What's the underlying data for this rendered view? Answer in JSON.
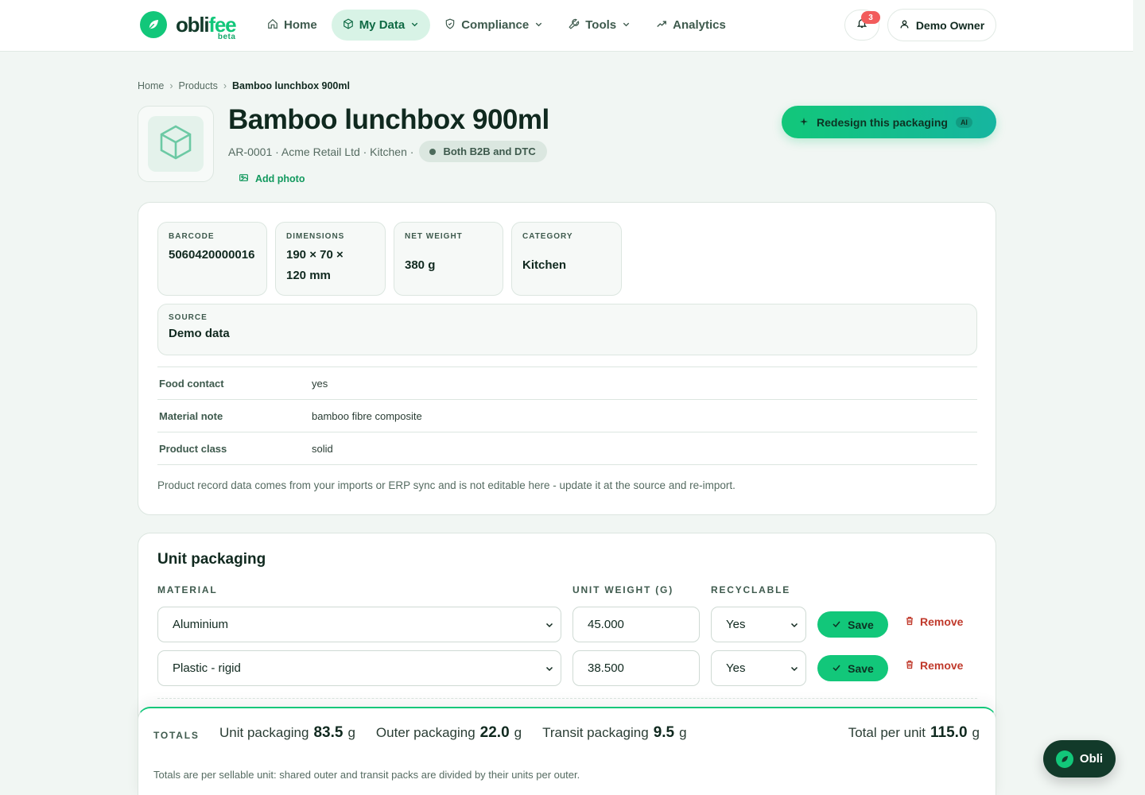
{
  "brand": {
    "name_main": "obli",
    "name_accent": "fee",
    "tag": "beta"
  },
  "nav": {
    "items": [
      {
        "label": "Home",
        "icon": "home-icon",
        "active": false,
        "dropdown": false
      },
      {
        "label": "My Data",
        "icon": "cube-icon",
        "active": true,
        "dropdown": true
      },
      {
        "label": "Compliance",
        "icon": "shield-icon",
        "active": false,
        "dropdown": true
      },
      {
        "label": "Tools",
        "icon": "wrench-icon",
        "active": false,
        "dropdown": true
      },
      {
        "label": "Analytics",
        "icon": "trend-icon",
        "active": false,
        "dropdown": false
      }
    ],
    "notifications_count": "3",
    "user_label": "Demo Owner"
  },
  "breadcrumb": {
    "items": [
      "Home",
      "Products",
      "Bamboo lunchbox 900ml"
    ]
  },
  "product": {
    "title": "Bamboo lunchbox 900ml",
    "meta": "AR-0001 · Acme Retail Ltd · Kitchen ·",
    "channel": "Both B2B and DTC",
    "add_photo": "Add photo",
    "redesign_label": "Redesign this packaging",
    "ai_tag": "AI"
  },
  "stats": {
    "barcode": {
      "label": "BARCODE",
      "value": "5060420000016"
    },
    "dimensions": {
      "label": "DIMENSIONS",
      "value": "190 × 70 × 120 mm"
    },
    "net_weight": {
      "label": "NET WEIGHT",
      "value": "380 g"
    },
    "category": {
      "label": "CATEGORY",
      "value": "Kitchen"
    },
    "source": {
      "label": "SOURCE",
      "value": "Demo data"
    }
  },
  "attributes": [
    {
      "key": "Food contact",
      "value": "yes"
    },
    {
      "key": "Material note",
      "value": "bamboo fibre composite"
    },
    {
      "key": "Product class",
      "value": "solid"
    }
  ],
  "record_note": "Product record data comes from your imports or ERP sync and is not editable here - update it at the source and re-import.",
  "unit_packaging": {
    "title": "Unit packaging",
    "columns": {
      "material": "MATERIAL",
      "weight": "UNIT WEIGHT (G)",
      "recyclable": "RECYCLABLE"
    },
    "rows": [
      {
        "material": "Aluminium",
        "weight": "45.000",
        "recyclable": "Yes"
      },
      {
        "material": "Plastic - rigid",
        "weight": "38.500",
        "recyclable": "Yes"
      }
    ],
    "save_label": "Save",
    "remove_label": "Remove"
  },
  "totals": {
    "label": "TOTALS",
    "unit": {
      "label": "Unit packaging",
      "value": "83.5",
      "unit": "g"
    },
    "outer": {
      "label": "Outer packaging",
      "value": "22.0",
      "unit": "g"
    },
    "transit": {
      "label": "Transit packaging",
      "value": "9.5",
      "unit": "g"
    },
    "grand": {
      "label": "Total per unit",
      "value": "115.0",
      "unit": "g"
    },
    "note": "Totals are per sellable unit: shared outer and transit packs are divided by their units per outer."
  },
  "chat": {
    "label": "Obli"
  },
  "colors": {
    "brand": "#12c77a",
    "ink": "#10291f",
    "danger": "#c0392b",
    "background": "#f1f6f3"
  }
}
